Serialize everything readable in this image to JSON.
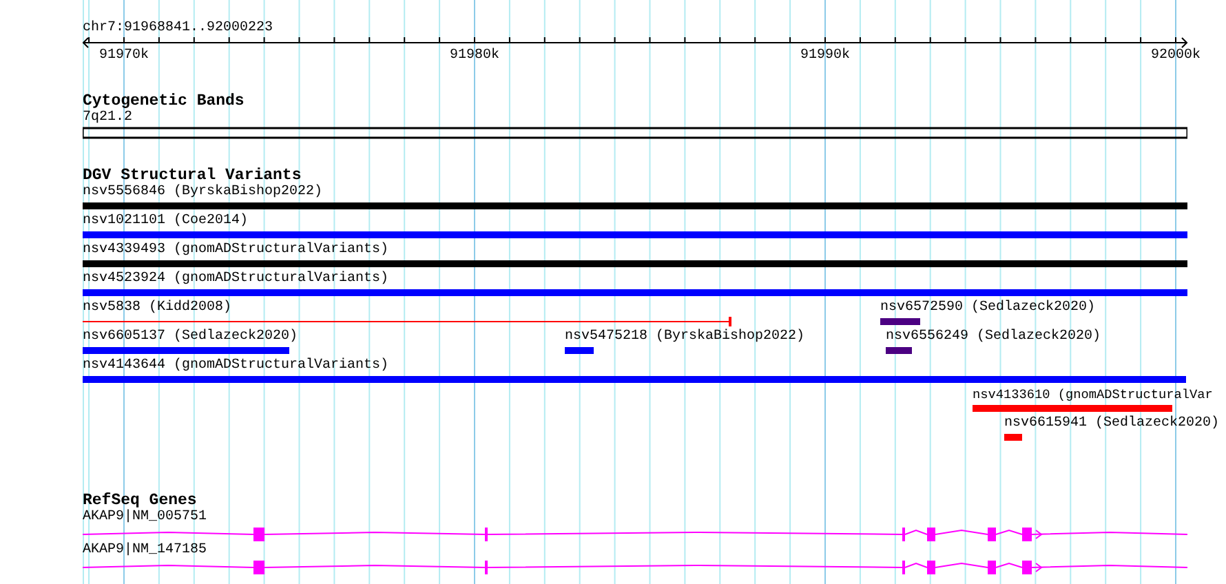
{
  "ruler": {
    "location": "chr7:91968841..92000223",
    "ticks": [
      "91970k",
      "91980k",
      "91990k",
      "92000k"
    ]
  },
  "tracks": [
    {
      "kind": "bands",
      "title": "Cytogenetic Bands",
      "features": [
        {
          "label": "7q21.2"
        }
      ]
    },
    {
      "kind": "variants",
      "title": "DGV Structural Variants",
      "features": [
        {
          "label": "nsv5556846 (ByrskaBishop2022)",
          "kind": "bar",
          "color": "#000000"
        },
        {
          "label": "nsv1021101 (Coe2014)",
          "kind": "bar",
          "color": "#0000ff"
        },
        {
          "label": "nsv4339493 (gnomADStructuralVariants)",
          "kind": "bar",
          "color": "#000000"
        },
        {
          "label": "nsv4523924 (gnomADStructuralVariants)",
          "kind": "bar",
          "color": "#0000ff"
        },
        {
          "label": "nsv5838 (Kidd2008)",
          "kind": "span",
          "color": "#ff0000"
        },
        {
          "label": "nsv6572590 (Sedlazeck2020)",
          "kind": "bar",
          "color": "#4b0082"
        },
        {
          "label": "nsv6605137 (Sedlazeck2020)",
          "kind": "bar",
          "color": "#0000ff"
        },
        {
          "label": "nsv5475218 (ByrskaBishop2022)",
          "kind": "bar",
          "color": "#0000ff"
        },
        {
          "label": "nsv6556249 (Sedlazeck2020)",
          "kind": "bar",
          "color": "#4b0082"
        },
        {
          "label": "nsv4143644 (gnomADStructuralVariants)",
          "kind": "bar",
          "color": "#0000ff"
        },
        {
          "label": "nsv4133610 (gnomADStructuralVar",
          "kind": "bar",
          "color": "#ff0000"
        },
        {
          "label": "nsv6615941 (Sedlazeck2020)",
          "kind": "bar",
          "color": "#ff0000"
        }
      ]
    },
    {
      "kind": "genes",
      "title": "RefSeq Genes",
      "features": [
        {
          "label": "AKAP9|NM_005751"
        },
        {
          "label": "AKAP9|NM_147185"
        }
      ]
    }
  ]
}
